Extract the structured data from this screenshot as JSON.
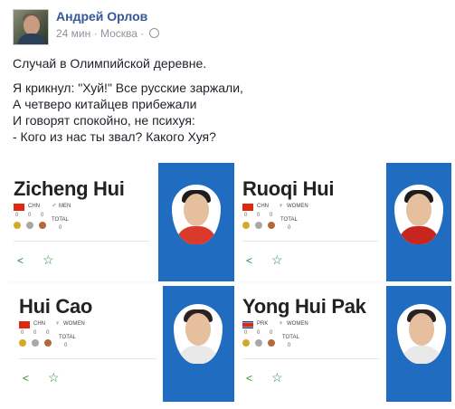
{
  "post": {
    "author": "Андрей Орлов",
    "time": "24 мин",
    "location": "Москва",
    "text_intro": "Случай в Олимпийской деревне.",
    "lines": [
      "Я крикнул: \"Хуй!\" Все русские заржали,",
      "А четверо китайцев прибежали",
      "И говорят спокойно, не психуя:",
      "- Кого из нас ты звал? Какого Хуя?"
    ]
  },
  "cards": [
    {
      "name": "Zicheng Hui",
      "country": "CHN",
      "gender": "MEN",
      "g": "0",
      "s": "0",
      "b": "0",
      "total_label": "TOTAL",
      "total": "0"
    },
    {
      "name": "Ruoqi Hui",
      "country": "CHN",
      "gender": "WOMEN",
      "g": "0",
      "s": "0",
      "b": "0",
      "total_label": "TOTAL",
      "total": "0"
    },
    {
      "name": "Hui Cao",
      "country": "CHN",
      "gender": "WOMEN",
      "g": "0",
      "s": "0",
      "b": "0",
      "total_label": "TOTAL",
      "total": "0"
    },
    {
      "name": "Yong Hui Pak",
      "country": "PRK",
      "gender": "WOMEN",
      "g": "0",
      "s": "0",
      "b": "0",
      "total_label": "TOTAL",
      "total": "0"
    }
  ],
  "colors": {
    "link": "#365899",
    "panel_blue": "#1f6cc0",
    "icon_green": "#2e8b3a"
  },
  "icons": {
    "share": "share-icon",
    "star": "star-icon",
    "gender": "gender-icon",
    "globe": "globe-icon"
  }
}
